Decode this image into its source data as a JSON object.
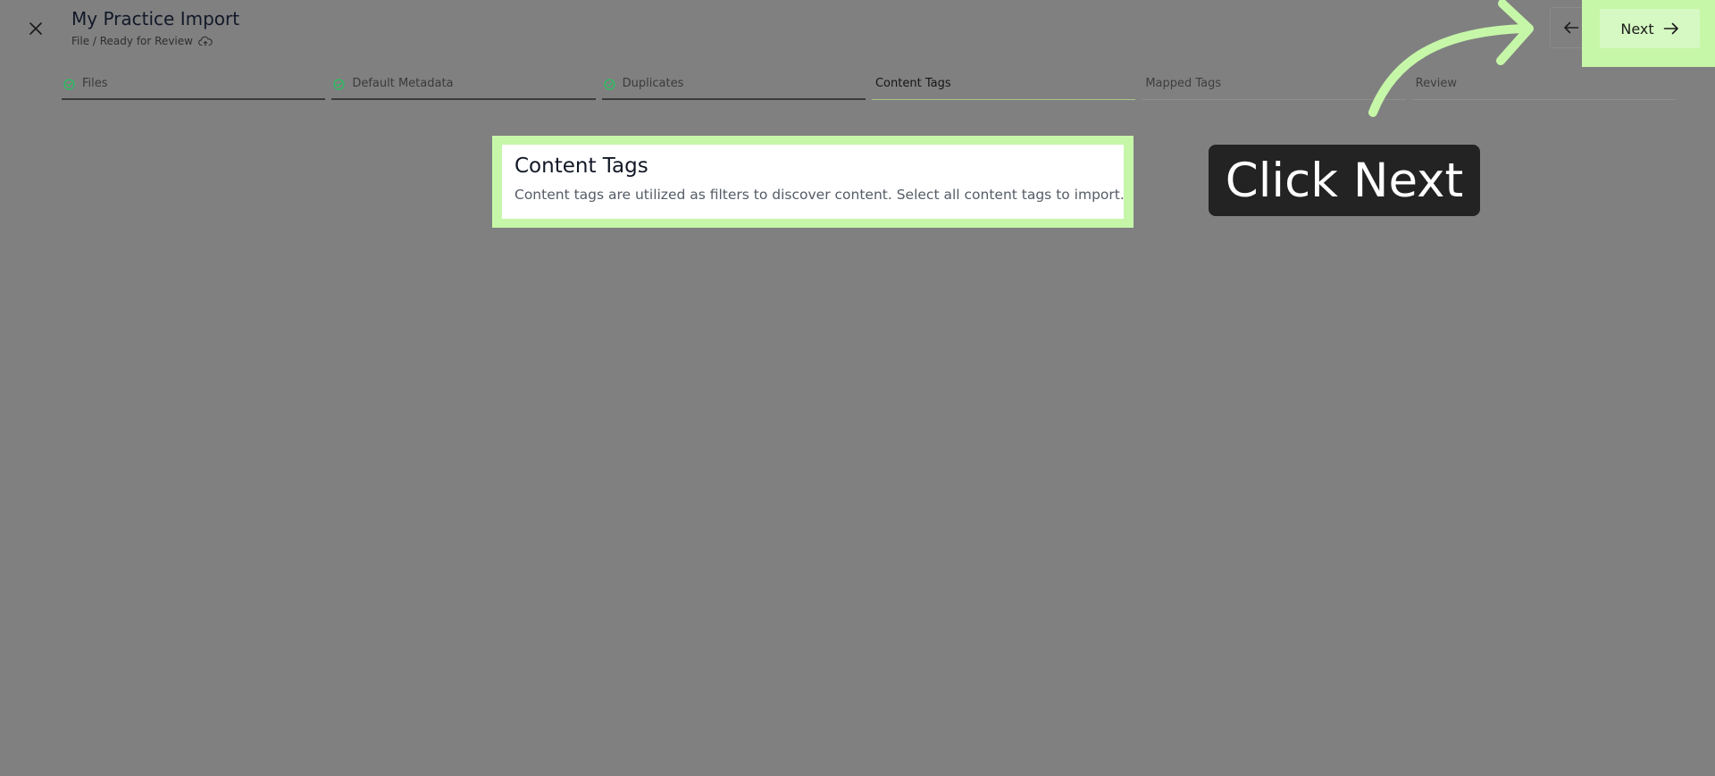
{
  "header": {
    "title": "My Practice Import",
    "subtitle": "File / Ready for Review"
  },
  "steps": [
    {
      "label": "Files",
      "state": "complete"
    },
    {
      "label": "Default Metadata",
      "state": "complete"
    },
    {
      "label": "Duplicates",
      "state": "complete"
    },
    {
      "label": "Content Tags",
      "state": "active"
    },
    {
      "label": "Mapped Tags",
      "state": "pending"
    },
    {
      "label": "Review",
      "state": "pending"
    }
  ],
  "nav": {
    "next_label": "Next"
  },
  "content": {
    "title": "Content Tags",
    "description": "Content tags are utilized as filters to discover content. Select all content tags to import."
  },
  "tooltip": {
    "text": "Click Next"
  },
  "icons": {
    "close": "close-icon",
    "cloud": "cloud-upload-icon",
    "check": "check-circle-icon",
    "back": "arrow-left-icon",
    "next": "arrow-right-icon"
  },
  "colors": {
    "overlay": "#808080",
    "highlight": "#c6f7a8",
    "check": "#22c55e",
    "tooltip_bg": "#232323"
  }
}
